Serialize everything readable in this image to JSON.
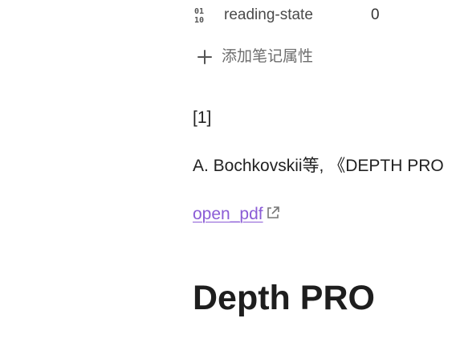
{
  "properties": [
    {
      "icon": "binary-number-icon",
      "key": "reading-state",
      "value": "0"
    }
  ],
  "add_property": {
    "icon": "plus-icon",
    "label": "添加笔记属性"
  },
  "reference": {
    "number": "[1]",
    "citation": "A. Bochkovskii等, 《DEPTH PRO",
    "link_label": "open_pdf",
    "link_icon": "external-link-icon"
  },
  "heading": "Depth PRO",
  "colors": {
    "link": "#8b5cd6",
    "text": "#222222",
    "muted": "#6e6e6e"
  }
}
